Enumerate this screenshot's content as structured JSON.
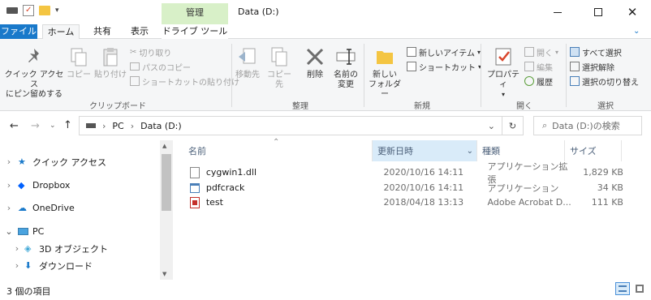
{
  "window": {
    "title": "Data (D:)",
    "context_tab": "管理"
  },
  "ribbon_tabs": {
    "file": "ファイル",
    "home": "ホーム",
    "share": "共有",
    "view": "表示",
    "drive_tools": "ドライブ ツール"
  },
  "clipboard": {
    "pin_line1": "クイック アクセス",
    "pin_line2": "にピン留めする",
    "copy": "コピー",
    "paste": "貼り付け",
    "cut": "切り取り",
    "copy_path": "パスのコピー",
    "paste_shortcut": "ショートカットの貼り付け",
    "label": "クリップボード"
  },
  "organize": {
    "move_to": "移動先",
    "copy_to": "コピー先",
    "delete": "削除",
    "rename_line1": "名前の",
    "rename_line2": "変更",
    "label": "整理"
  },
  "new": {
    "new_folder_line1": "新しい",
    "new_folder_line2": "フォルダー",
    "new_item": "新しいアイテム",
    "easy_access": "ショートカット",
    "label": "新規"
  },
  "open": {
    "properties": "プロパティ",
    "open": "開く",
    "edit": "編集",
    "history": "履歴",
    "label": "開く"
  },
  "select": {
    "select_all": "すべて選択",
    "select_none": "選択解除",
    "invert": "選択の切り替え",
    "label": "選択"
  },
  "address": {
    "parts": [
      "PC",
      "Data (D:)"
    ],
    "search_placeholder": "Data (D:)の検索"
  },
  "nav": {
    "quick_access": "クイック アクセス",
    "dropbox": "Dropbox",
    "onedrive": "OneDrive",
    "pc": "PC",
    "objects3d": "3D オブジェクト",
    "downloads": "ダウンロード"
  },
  "columns": {
    "name": "名前",
    "date": "更新日時",
    "type": "種類",
    "size": "サイズ"
  },
  "files": [
    {
      "name": "cygwin1.dll",
      "date": "2020/10/16 14:11",
      "type": "アプリケーション拡張",
      "size": "1,829 KB"
    },
    {
      "name": "pdfcrack",
      "date": "2020/10/16 14:11",
      "type": "アプリケーション",
      "size": "34 KB"
    },
    {
      "name": "test",
      "date": "2018/04/18 13:13",
      "type": "Adobe Acrobat D...",
      "size": "111 KB"
    }
  ],
  "status": {
    "item_count": "3 個の項目"
  },
  "colors": {
    "file_tab": "#1979ca",
    "context_tab": "#d8f0c8",
    "sort_header": "#d9ebf9"
  }
}
